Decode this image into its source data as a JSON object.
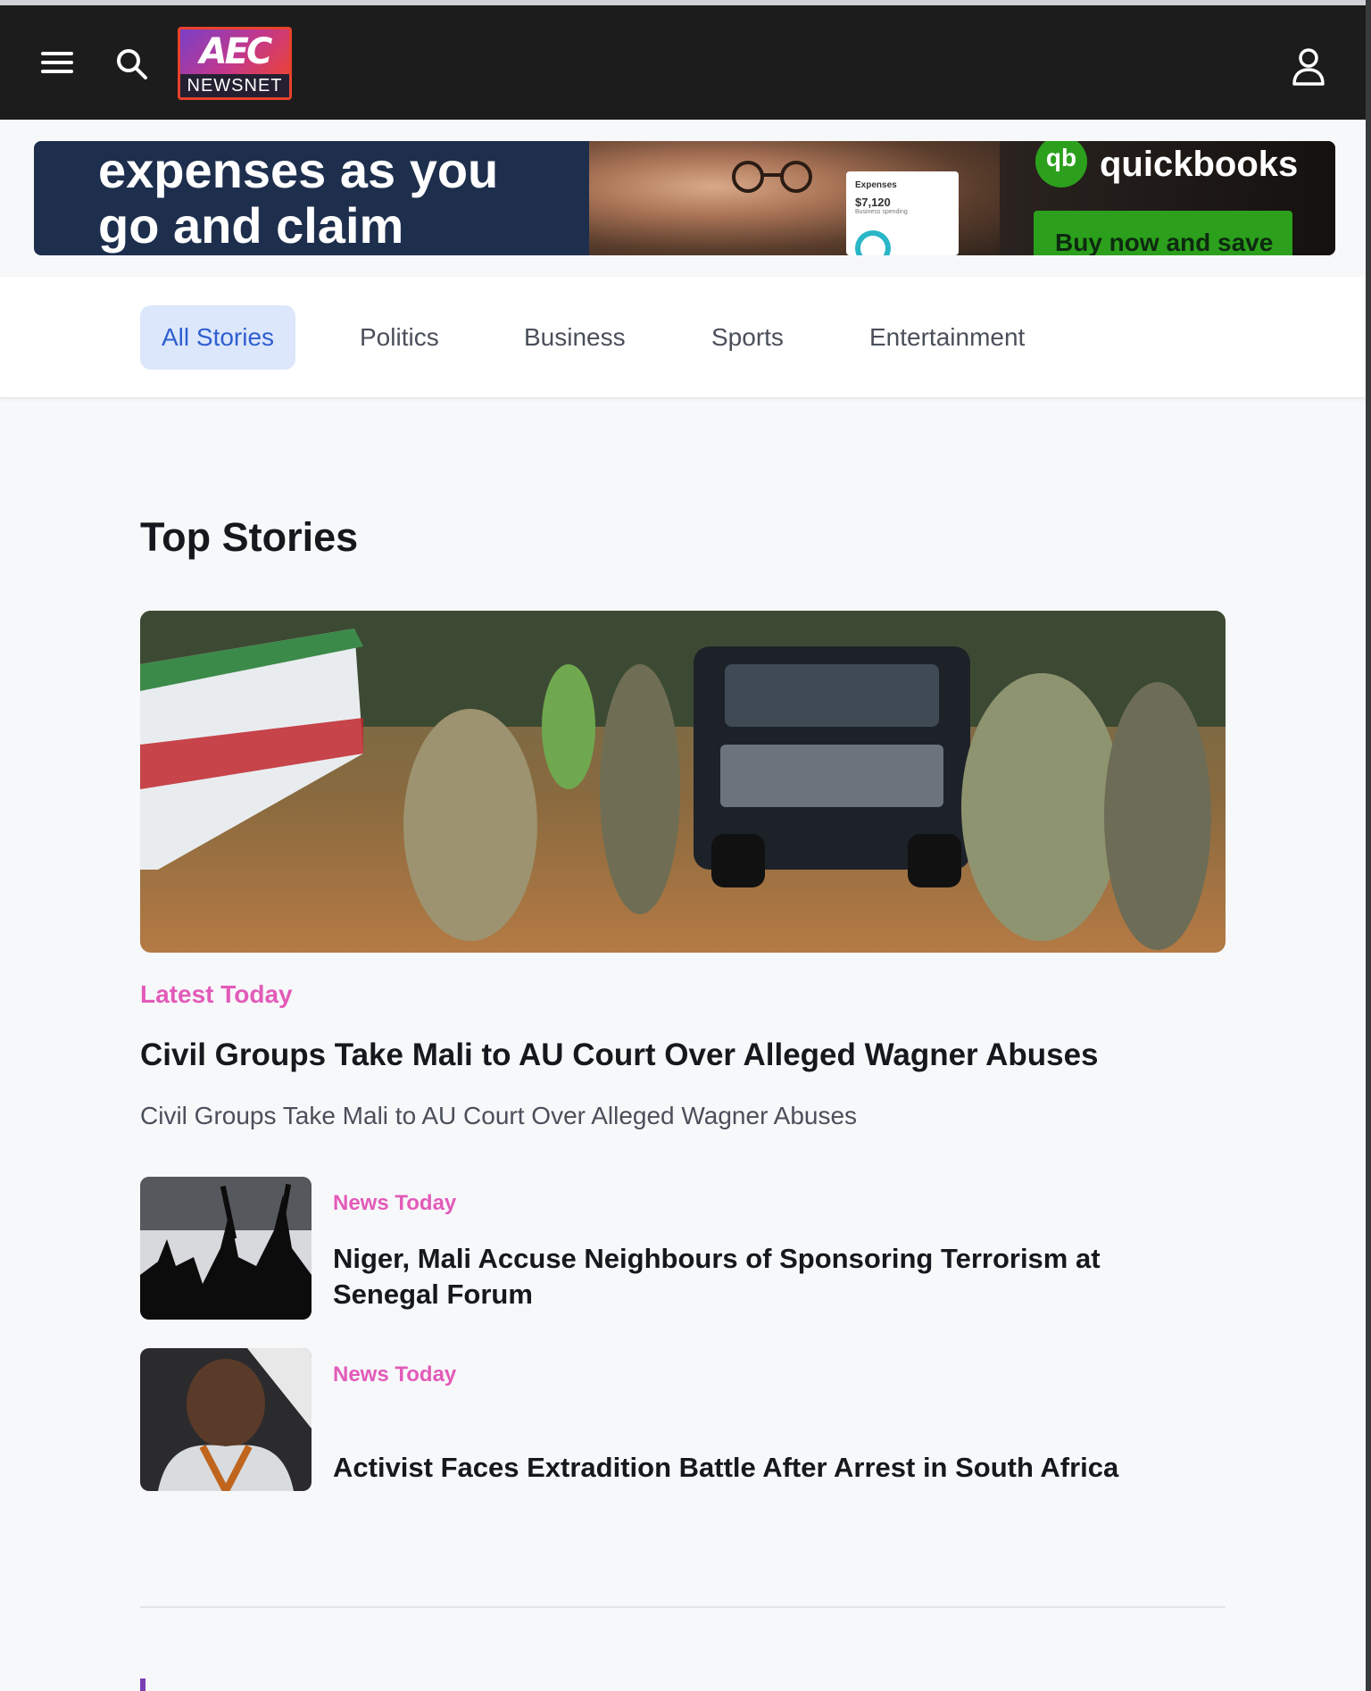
{
  "header": {
    "logo_mark": "AEC",
    "logo_text": "NEWSNET"
  },
  "ad": {
    "line1": "expenses as you",
    "line2": "go and claim",
    "card_title": "Expenses",
    "card_amount": "$7,120",
    "card_sub": "Business spending",
    "brand_mark": "qb",
    "brand_name": "quickbooks",
    "cta": "Buy now and save"
  },
  "tabs": [
    {
      "label": "All Stories",
      "active": true
    },
    {
      "label": "Politics",
      "active": false
    },
    {
      "label": "Business",
      "active": false
    },
    {
      "label": "Sports",
      "active": false
    },
    {
      "label": "Entertainment",
      "active": false
    }
  ],
  "top_stories": {
    "title": "Top Stories",
    "featured": {
      "kicker": "Latest Today",
      "headline": "Civil Groups Take Mali to AU Court Over Alleged Wagner Abuses",
      "summary": "Civil Groups Take Mali to AU Court Over Alleged Wagner Abuses"
    },
    "stories": [
      {
        "kicker": "News Today",
        "headline": "Niger, Mali Accuse Neighbours of Sponsoring Terrorism at Senegal Forum"
      },
      {
        "kicker": "News Today",
        "headline": "Activist Faces Extradition Battle After Arrest in South Africa"
      }
    ]
  },
  "colors": {
    "header_bg": "#1c1c1c",
    "kicker": "#e25bb9",
    "tab_active_bg": "#dce7fb",
    "tab_active_text": "#2f5fd0"
  }
}
